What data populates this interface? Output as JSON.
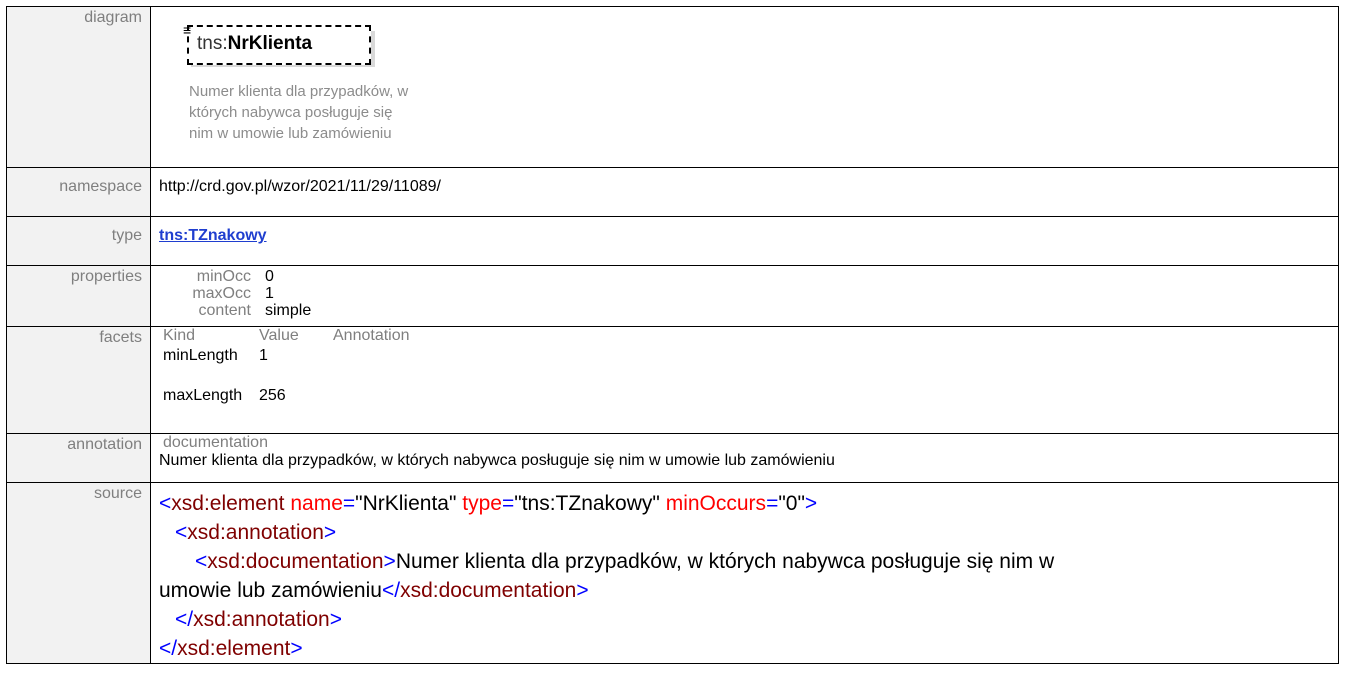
{
  "labels": {
    "diagram": "diagram",
    "namespace": "namespace",
    "type": "type",
    "properties": "properties",
    "facets": "facets",
    "annotation": "annotation",
    "source": "source"
  },
  "diagram": {
    "prefix": "tns:",
    "name": "NrKlienta",
    "note_lines": [
      "Numer klienta dla przypadków, w",
      "których nabywca posługuje się",
      "nim w umowie lub zamówieniu"
    ]
  },
  "namespace": "http://crd.gov.pl/wzor/2021/11/29/11089/",
  "type": "tns:TZnakowy",
  "properties": [
    {
      "key": "minOcc",
      "value": "0"
    },
    {
      "key": "maxOcc",
      "value": "1"
    },
    {
      "key": "content",
      "value": "simple"
    }
  ],
  "facets": {
    "headers": [
      "Kind",
      "Value",
      "Annotation"
    ],
    "rows": [
      {
        "kind": "minLength",
        "value": "1"
      },
      {
        "kind": "maxLength",
        "value": "256"
      }
    ]
  },
  "annotation": {
    "header": "documentation",
    "text": "Numer klienta dla przypadków, w których nabywca posługuje się nim w umowie lub zamówieniu"
  },
  "source": {
    "open_tag": "<xsd:element",
    "attr_name": "name",
    "attr_name_val": "\"NrKlienta\"",
    "attr_type": "type",
    "attr_type_val": "\"tns:TZnakowy\"",
    "attr_min": "minOccurs",
    "attr_min_val": "\"0\"",
    "close_angle": ">",
    "ann_open": "<xsd:annotation>",
    "doc_open": "<xsd:documentation>",
    "doc_text_1": "Numer klienta dla przypadków, w których nabywca posługuje się nim w",
    "doc_text_2": "umowie lub zamówieniu",
    "doc_close": "</xsd:documentation>",
    "ann_close": "</xsd:annotation>",
    "el_close": "</xsd:element>"
  },
  "colors": {
    "tag": "#7f0000",
    "bracket": "#0000ff",
    "attr": "#ff0000",
    "link": "#1f3ecf",
    "label_bg": "#f2f2f2"
  }
}
